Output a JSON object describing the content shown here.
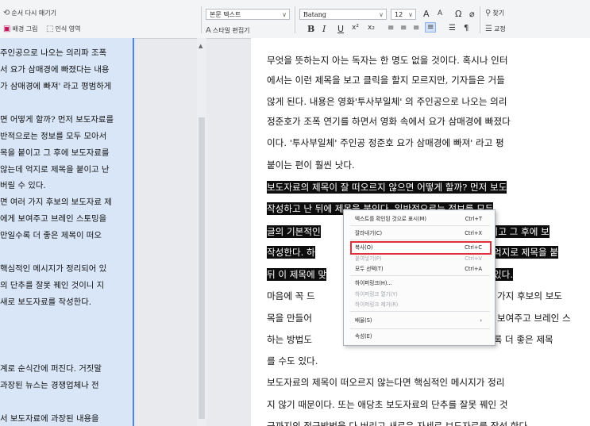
{
  "toolbar": {
    "row1_left": "순서 다시 매기기",
    "row2_bg": "배경 그림",
    "row2_recognize": "인식 영역",
    "style_select": "본문 텍스트",
    "style_editor": "스타일 편집기",
    "font_select": "Batang",
    "size_select": "12",
    "grow_font": "A",
    "shrink_font": "A",
    "omega": "Ω",
    "link": "⌀",
    "find": "찾기",
    "proofread": "교정",
    "bold": "B",
    "italic": "I",
    "underline": "U",
    "superscript": "x²",
    "subscript": "x₂"
  },
  "left_pane": {
    "lines": [
      "주인공으로 나오는 의리파 조폭",
      "서 요가 삼매경에 빠졌다는 내용",
      "가 삼매경에 빠져' 라고 평범하게",
      "",
      "면 어떻게 할까? 먼저 보도자료를",
      "반적으로는 정보를 모두 모아서",
      "목을 붙이고 그 후에 보도자료를",
      "않는데 억지로 제목을 붙이고 난",
      "버릴 수 있다.",
      "면 여러 가지 후보의 보도자료 제",
      "에게 보여주고 브레인 스토밍을",
      "만일수록 더 좋은 제목이 떠오",
      "",
      "핵심적인 메시지가 정리되어 있",
      "의 단추를 잘못 꿰인 것이니 지",
      "새로 보도자료를 작성한다.",
      "",
      "",
      "",
      "계로 순식간에 퍼진다. 거짓말",
      "과장된 뉴스는 경쟁업체나 전",
      "",
      "서 보도자료에 과장된 내용을"
    ]
  },
  "document": {
    "lines": [
      "무엇을 뜻하는지 아는 독자는 한 명도 없을 것이다. 혹시나 인터",
      "에서는 이런 제목을 보고 클릭을 할지 모르지만, 기자들은 거들",
      "않게 된다. 내용은 영화'투사부일체' 의 주인공으로 나오는 의리",
      "정준호가 조폭 연기를 하면서 영화 속에서 요가 삼매경에 빠졌다",
      "이다. '투사부일체' 주인공 정준호 요가 삼매경에 빠져' 라고 평",
      "붙이는 편이 훨씬 낫다.",
      " 보도자료의 제목이 잘 떠오르지 않으면 어떻게 할까? 먼저 보도",
      "작성하고 난 뒤에 제목을 붙인다. 일반적으로는 정보를 모두",
      "글의 기본적인",
      "작성한다. 하",
      "뒤 이 제목에 맞",
      " 마음에 꼭 드",
      "목을 만들어",
      "하는 방법도",
      "를 수도 있다.",
      " 보도자료의 제목이 떠오르지 않는다면 핵심적인 메시지가 정리",
      "지 않기 때문이다. 또는 애당초 보도자료의 단추를 잘못 꿰인 것",
      "금까지의 접근방법을 다 버리고 새로운 자세로 보도자료를 작성 한다"
    ],
    "right_fragments": {
      "l8": "붙이고 그 후에 보",
      "l9": "억지로 제목을 붙",
      "l10": "있다.",
      "l11": "가지 후보의 보도",
      "l12": "보여주고 브레인 스",
      "l13": "수록 더 좋은 제목"
    }
  },
  "context_menu": {
    "items": [
      {
        "label": "텍스트를 확인된 것으로 표시(M)",
        "shortcut": "Ctrl+T",
        "disabled": false
      },
      {
        "label": "잘라내기(C)",
        "shortcut": "Ctrl+X",
        "disabled": false
      },
      {
        "label": "복사(O)",
        "shortcut": "Ctrl+C",
        "disabled": false
      },
      {
        "label": "붙여넣기(P)",
        "shortcut": "Ctrl+V",
        "disabled": true
      },
      {
        "label": "모두 선택(T)",
        "shortcut": "Ctrl+A",
        "disabled": false
      },
      {
        "label": "하이퍼링크(H)...",
        "shortcut": "",
        "disabled": false
      },
      {
        "label": "하이퍼링크 열기(Y)",
        "shortcut": "",
        "disabled": true
      },
      {
        "label": "하이퍼링크 제거(R)",
        "shortcut": "",
        "disabled": true
      },
      {
        "label": "배율(S)",
        "shortcut": "›",
        "disabled": false
      },
      {
        "label": "속성(E)",
        "shortcut": "",
        "disabled": false
      }
    ],
    "highlight_color": "#e0303b"
  }
}
